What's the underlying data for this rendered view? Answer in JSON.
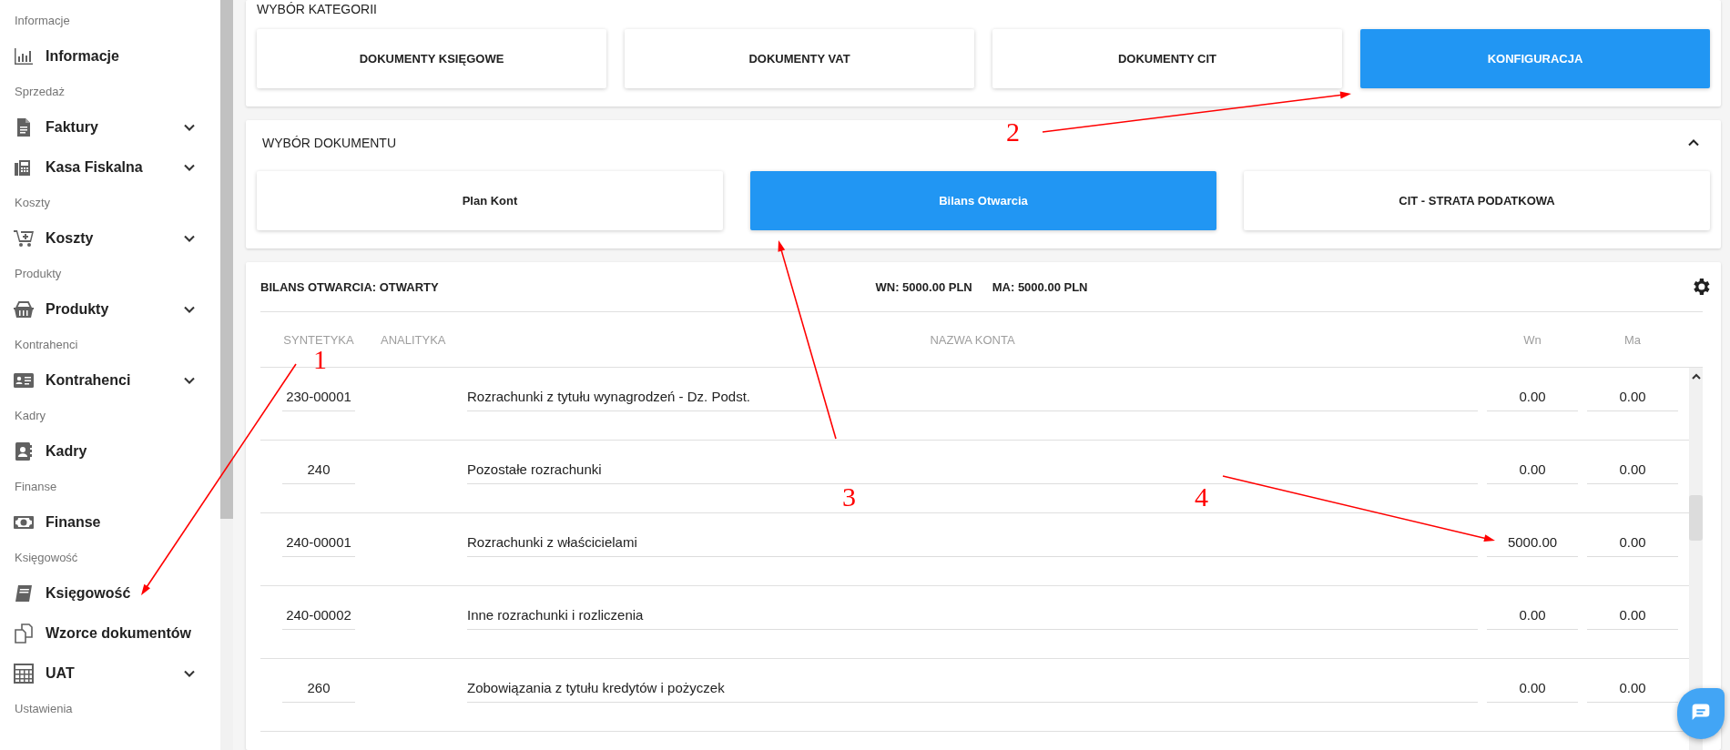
{
  "sidebar": {
    "sections": [
      {
        "header": "Informacje",
        "items": [
          {
            "label": "Informacje",
            "expandable": false
          }
        ]
      },
      {
        "header": "Sprzedaż",
        "items": [
          {
            "label": "Faktury",
            "expandable": true
          },
          {
            "label": "Kasa Fiskalna",
            "expandable": true
          }
        ]
      },
      {
        "header": "Koszty",
        "items": [
          {
            "label": "Koszty",
            "expandable": true
          }
        ]
      },
      {
        "header": "Produkty",
        "items": [
          {
            "label": "Produkty",
            "expandable": true
          }
        ]
      },
      {
        "header": "Kontrahenci",
        "items": [
          {
            "label": "Kontrahenci",
            "expandable": true
          }
        ]
      },
      {
        "header": "Kadry",
        "items": [
          {
            "label": "Kadry",
            "expandable": false
          }
        ]
      },
      {
        "header": "Finanse",
        "items": [
          {
            "label": "Finanse",
            "expandable": false
          }
        ]
      },
      {
        "header": "Księgowość",
        "items": [
          {
            "label": "Księgowość",
            "expandable": false
          },
          {
            "label": "Wzorce dokumentów",
            "expandable": false
          },
          {
            "label": "UAT",
            "expandable": true
          }
        ]
      },
      {
        "header": "Ustawienia"
      }
    ]
  },
  "categories": {
    "title": "WYBÓR KATEGORII",
    "buttons": [
      {
        "label": "DOKUMENTY KSIĘGOWE",
        "selected": false
      },
      {
        "label": "DOKUMENTY VAT",
        "selected": false
      },
      {
        "label": "DOKUMENTY CIT",
        "selected": false
      },
      {
        "label": "KONFIGURACJA",
        "selected": true
      }
    ]
  },
  "documents": {
    "title": "WYBÓR DOKUMENTU",
    "expanded": true,
    "buttons": [
      {
        "label": "Plan Kont",
        "selected": false
      },
      {
        "label": "Bilans Otwarcia",
        "selected": true
      },
      {
        "label": "CIT - STRATA PODATKOWA",
        "selected": false
      }
    ]
  },
  "balance": {
    "title": "BILANS OTWARCIA: OTWARTY",
    "wn_total": "WN: 5000.00 PLN",
    "ma_total": "MA: 5000.00 PLN",
    "columns": [
      "SYNTETYKA",
      "ANALITYKA",
      "NAZWA KONTA",
      "Wn",
      "Ma"
    ],
    "rows": [
      {
        "syntetyka": "230-00001",
        "nazwa": "Rozrachunki z tytułu wynagrodzeń - Dz. Podst.",
        "wn": "0.00",
        "ma": "0.00"
      },
      {
        "syntetyka": "240",
        "nazwa": "Pozostałe rozrachunki",
        "wn": "0.00",
        "ma": "0.00"
      },
      {
        "syntetyka": "240-00001",
        "nazwa": "Rozrachunki z właścicielami",
        "wn": "5000.00",
        "ma": "0.00"
      },
      {
        "syntetyka": "240-00002",
        "nazwa": "Inne rozrachunki i rozliczenia",
        "wn": "0.00",
        "ma": "0.00"
      },
      {
        "syntetyka": "260",
        "nazwa": "Zobowiązania z tytułu kredytów i pożyczek",
        "wn": "0.00",
        "ma": "0.00"
      }
    ]
  },
  "annotations": [
    {
      "label": "1"
    },
    {
      "label": "2"
    },
    {
      "label": "3"
    },
    {
      "label": "4"
    }
  ]
}
